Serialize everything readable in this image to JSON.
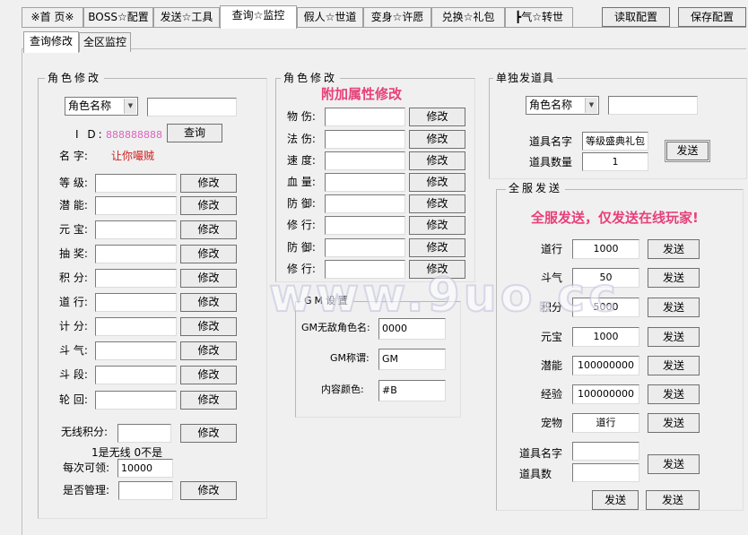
{
  "top_tabs": [
    {
      "label": "※首 页※"
    },
    {
      "label": "BOSS☆配置"
    },
    {
      "label": "发送☆工具"
    },
    {
      "label": "查询☆监控"
    },
    {
      "label": "假人☆世道"
    },
    {
      "label": "变身☆许愿"
    },
    {
      "label": "兑换☆礼包"
    },
    {
      "label": "┣气☆转世"
    }
  ],
  "top_buttons": {
    "read": "读取配置",
    "save": "保存配置"
  },
  "sub_tabs": [
    {
      "label": "查询修改"
    },
    {
      "label": "全区监控"
    }
  ],
  "role_modify": {
    "title": "角色修改",
    "select_value": "角色名称",
    "name_input": "",
    "id_label": "I D:",
    "id_value": "888888888",
    "query_button": "查询",
    "name_label": "名 字:",
    "name_value": "让你嘬贼",
    "fields": [
      {
        "label": "等 级:",
        "value": "",
        "button": "修改"
      },
      {
        "label": "潜 能:",
        "value": "",
        "button": "修改"
      },
      {
        "label": "元 宝:",
        "value": "",
        "button": "修改"
      },
      {
        "label": "抽 奖:",
        "value": "",
        "button": "修改"
      },
      {
        "label": "积 分:",
        "value": "",
        "button": "修改"
      },
      {
        "label": "道 行:",
        "value": "",
        "button": "修改"
      },
      {
        "label": "计 分:",
        "value": "",
        "button": "修改"
      },
      {
        "label": "斗 气:",
        "value": "",
        "button": "修改"
      },
      {
        "label": "斗 段:",
        "value": "",
        "button": "修改"
      },
      {
        "label": "轮 回:",
        "value": "",
        "button": "修改"
      }
    ],
    "wireless_label": "无线积分:",
    "wireless_value": "",
    "wireless_button": "修改",
    "wireless_note": "1是无线 0不是",
    "each_label": "每次可领:",
    "each_value": "10000",
    "admin_label": "是否管理:",
    "admin_value": "",
    "admin_button": "修改"
  },
  "attr_modify": {
    "title": "角色修改",
    "heading": "附加属性修改",
    "fields": [
      {
        "label": "物 伤:",
        "value": "",
        "button": "修改"
      },
      {
        "label": "法 伤:",
        "value": "",
        "button": "修改"
      },
      {
        "label": "速 度:",
        "value": "",
        "button": "修改"
      },
      {
        "label": "血 量:",
        "value": "",
        "button": "修改"
      },
      {
        "label": "防 御:",
        "value": "",
        "button": "修改"
      },
      {
        "label": "修 行:",
        "value": "",
        "button": "修改"
      },
      {
        "label": "防 御:",
        "value": "",
        "button": "修改"
      },
      {
        "label": "修 行:",
        "value": "",
        "button": "修改"
      }
    ]
  },
  "gm": {
    "title": "GM设置",
    "rows": [
      {
        "label": "GM无敌角色名:",
        "value": "0000"
      },
      {
        "label": "GM称谓:",
        "value": "GM"
      },
      {
        "label": "内容颜色:",
        "value": "#B"
      }
    ]
  },
  "single_send": {
    "title": "单独发道具",
    "select_value": "角色名称",
    "name_input": "",
    "item_name_label": "道具名字",
    "item_name_value": "等级盛典礼包",
    "item_count_label": "道具数量",
    "item_count_value": "1",
    "send_button": "发送"
  },
  "server_send": {
    "title": "全服发送",
    "heading": "全服发送，仅发送在线玩家!",
    "rows": [
      {
        "label": "道行",
        "value": "1000",
        "button": "发送"
      },
      {
        "label": "斗气",
        "value": "50",
        "button": "发送"
      },
      {
        "label": "积分",
        "value": "5000",
        "button": "发送"
      },
      {
        "label": "元宝",
        "value": "1000",
        "button": "发送"
      },
      {
        "label": "潜能",
        "value": "100000000",
        "button": "发送"
      },
      {
        "label": "经验",
        "value": "100000000",
        "button": "发送"
      },
      {
        "label": "宠物",
        "value": "道行",
        "button": "发送"
      }
    ],
    "item_name_label": "道具名字",
    "item_count_label": "道具数",
    "item_name_value": "",
    "item_count_value": "",
    "item_button": "发送",
    "bottom_button_left": "发送",
    "bottom_button_right": "发送"
  },
  "watermark": "www.9uo.cc"
}
